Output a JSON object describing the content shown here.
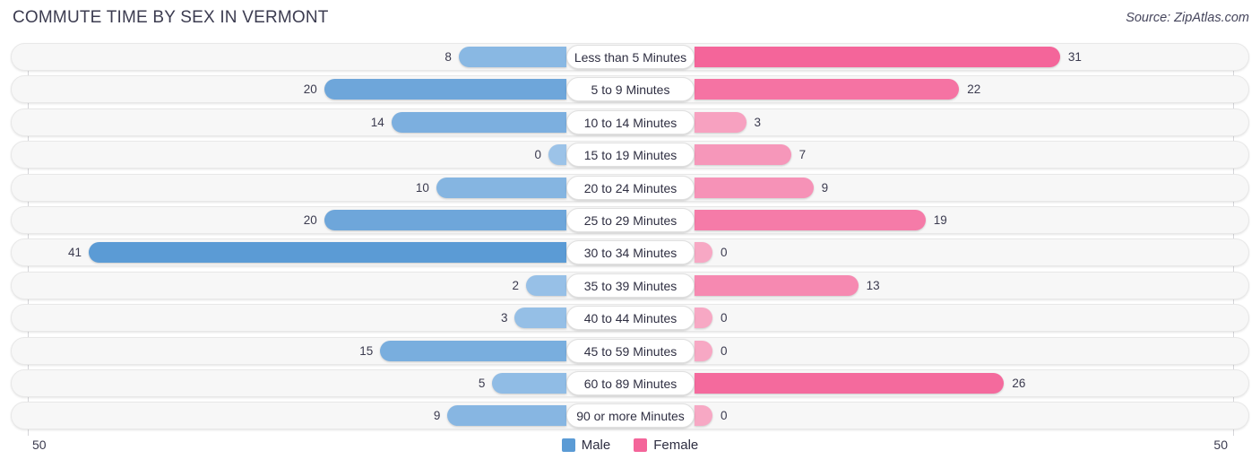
{
  "header": {
    "title": "COMMUTE TIME BY SEX IN VERMONT",
    "source": "Source: ZipAtlas.com"
  },
  "legend": {
    "position": "bottom-center",
    "items": [
      {
        "label": "Male",
        "color": "#5b9bd5"
      },
      {
        "label": "Female",
        "color": "#f4659a"
      }
    ]
  },
  "axis": {
    "left_tick": "50",
    "right_tick": "50",
    "max": 50
  },
  "colors": {
    "male_strong": "#5b9bd5",
    "male_light": "#9cc3e8",
    "female_strong": "#f4659a",
    "female_light": "#f7a8c4",
    "track": "#f7f7f7",
    "track_border": "#e8e8e8",
    "text": "#3b3b4f"
  },
  "chart_data": {
    "type": "bar",
    "orientation": "horizontal-diverging",
    "title": "COMMUTE TIME BY SEX IN VERMONT",
    "subtitle": "",
    "xlabel": "",
    "ylabel": "",
    "xlim": [
      50,
      50
    ],
    "grid": false,
    "legend_position": "bottom-center",
    "categories": [
      "Less than 5 Minutes",
      "5 to 9 Minutes",
      "10 to 14 Minutes",
      "15 to 19 Minutes",
      "20 to 24 Minutes",
      "25 to 29 Minutes",
      "30 to 34 Minutes",
      "35 to 39 Minutes",
      "40 to 44 Minutes",
      "45 to 59 Minutes",
      "60 to 89 Minutes",
      "90 or more Minutes"
    ],
    "series": [
      {
        "name": "Male",
        "color": "#5b9bd5",
        "side": "left",
        "values": [
          8,
          20,
          14,
          0,
          10,
          20,
          41,
          2,
          3,
          15,
          5,
          9
        ]
      },
      {
        "name": "Female",
        "color": "#f4659a",
        "side": "right",
        "values": [
          31,
          22,
          3,
          7,
          9,
          19,
          0,
          13,
          0,
          0,
          26,
          0
        ]
      }
    ]
  }
}
